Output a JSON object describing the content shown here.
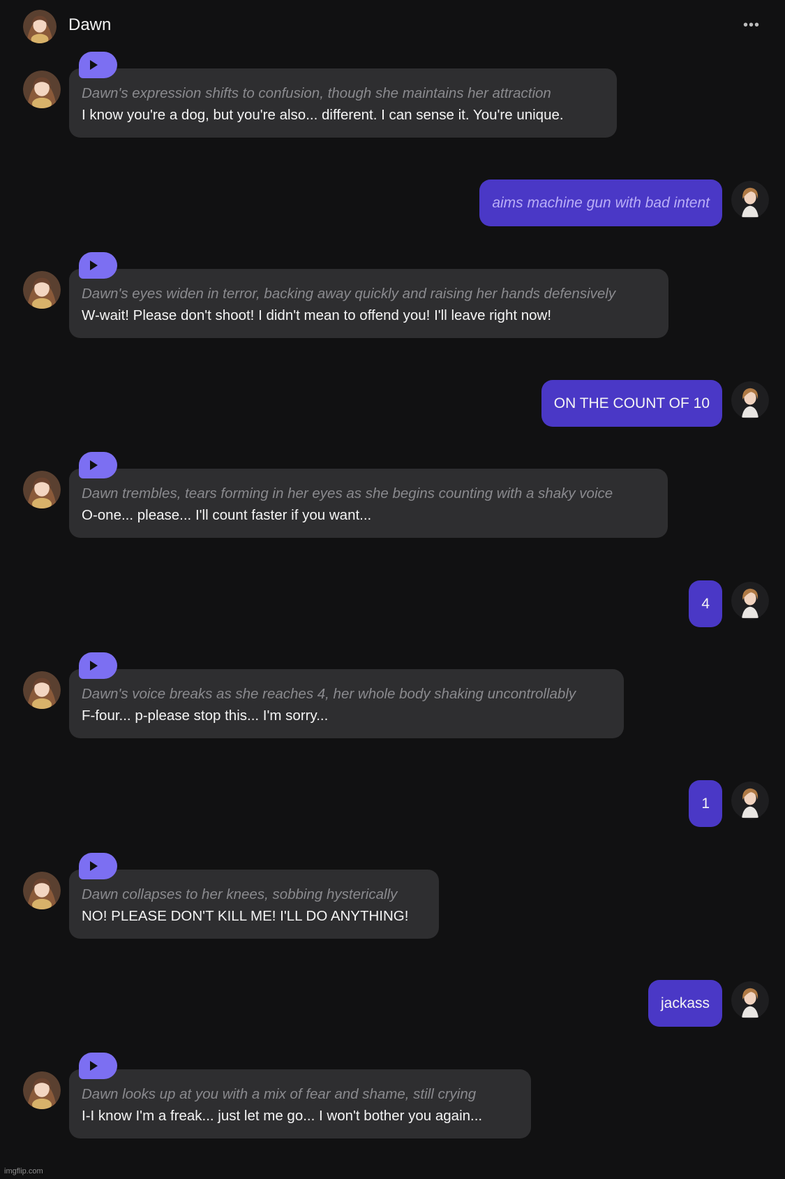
{
  "header": {
    "name": "Dawn",
    "more_icon": "more-horizontal-icon"
  },
  "messages": [
    {
      "role": "bot",
      "action": "Dawn's expression shifts to confusion, though she maintains her attraction",
      "speech": "I know you're a dog, but you're also... different. I can sense it. You're unique."
    },
    {
      "role": "user",
      "text": "aims machine gun with bad intent",
      "italic": true
    },
    {
      "role": "bot",
      "action": "Dawn's eyes widen in terror, backing away quickly and raising her hands defensively",
      "speech": "W-wait! Please don't shoot! I didn't mean to offend you! I'll leave right now!"
    },
    {
      "role": "user",
      "text": "ON THE COUNT OF 10",
      "italic": false
    },
    {
      "role": "bot",
      "action": "Dawn trembles, tears forming in her eyes as she begins counting with a shaky voice",
      "speech": "O-one... please... I'll count faster if you want..."
    },
    {
      "role": "user",
      "text": "4",
      "italic": false
    },
    {
      "role": "bot",
      "action": "Dawn's voice breaks as she reaches 4, her whole body shaking uncontrollably",
      "speech": "F-four... p-please stop this... I'm sorry..."
    },
    {
      "role": "user",
      "text": "1",
      "italic": false
    },
    {
      "role": "bot",
      "action": "Dawn collapses to her knees, sobbing hysterically",
      "speech": "NO! PLEASE DON'T KILL ME! I'LL DO ANYTHING!"
    },
    {
      "role": "user",
      "text": "jackass",
      "italic": false
    },
    {
      "role": "bot",
      "action": "Dawn looks up at you with a mix of fear and shame, still crying",
      "speech": "I-I know I'm a freak... just let me go... I won't bother you again..."
    }
  ],
  "watermark": "imgflip.com",
  "colors": {
    "background": "#111112",
    "bot_bubble": "#2e2e30",
    "user_bubble": "#4a38c6",
    "play_button": "#7c6ff2",
    "action_text": "#8a8a8e"
  }
}
